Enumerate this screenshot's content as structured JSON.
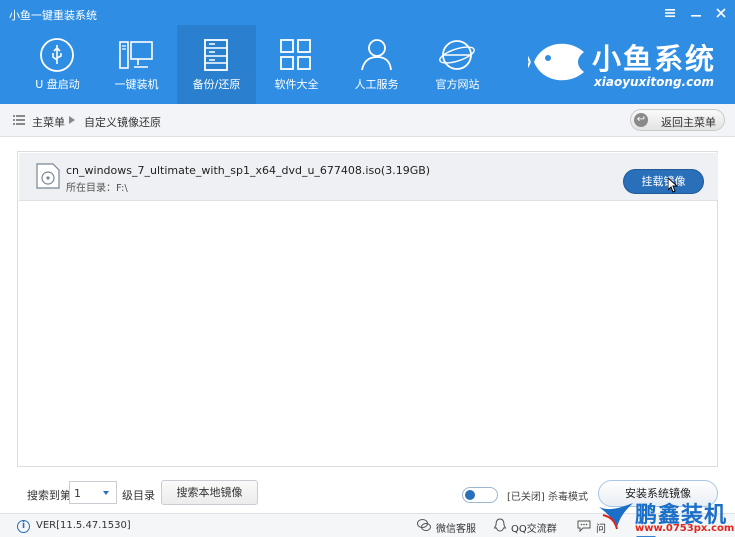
{
  "window": {
    "title": "小鱼一键重装系统",
    "controls": [
      "menu-icon",
      "minimize-icon",
      "close-icon"
    ]
  },
  "nav": {
    "tabs": [
      {
        "label": "U 盘启动",
        "icon": "usb-icon",
        "active": false
      },
      {
        "label": "一键装机",
        "icon": "computer-icon",
        "active": false
      },
      {
        "label": "备份/还原",
        "icon": "server-icon",
        "active": true
      },
      {
        "label": "软件大全",
        "icon": "grid-apps-icon",
        "active": false
      },
      {
        "label": "人工服务",
        "icon": "person-icon",
        "active": false
      },
      {
        "label": "官方网站",
        "icon": "globe-icon",
        "active": false
      }
    ]
  },
  "brand": {
    "name": "小鱼系统",
    "url": "xiaoyuxitong.com"
  },
  "breadcrumb": {
    "items": [
      "主菜单",
      "自定义镜像还原"
    ],
    "back_label": "返回主菜单"
  },
  "file": {
    "name": "cn_windows_7_ultimate_with_sp1_x64_dvd_u_677408.iso(3.19GB)",
    "dir": "所在目录：F:\\",
    "mount_label": "挂载镜像"
  },
  "search": {
    "prefix": "搜索到第",
    "level": "1",
    "suffix": "级目录",
    "local_button": "搜索本地镜像"
  },
  "kill_mode": {
    "state_label": "[已关闭] 杀毒模式"
  },
  "install_button": "安装系统镜像",
  "status": {
    "version": "VER[11.5.47.1530]",
    "wechat": "微信客服",
    "qq": "QQ交流群",
    "question": "问"
  },
  "watermark": {
    "text": "鹏鑫装机网",
    "url": "www.0753px.com"
  },
  "colors": {
    "header_blue": "#2f8ee4",
    "active_tab": "#2a80cf",
    "button_blue": "#2a6fba",
    "watermark_red": "#e0261c"
  }
}
